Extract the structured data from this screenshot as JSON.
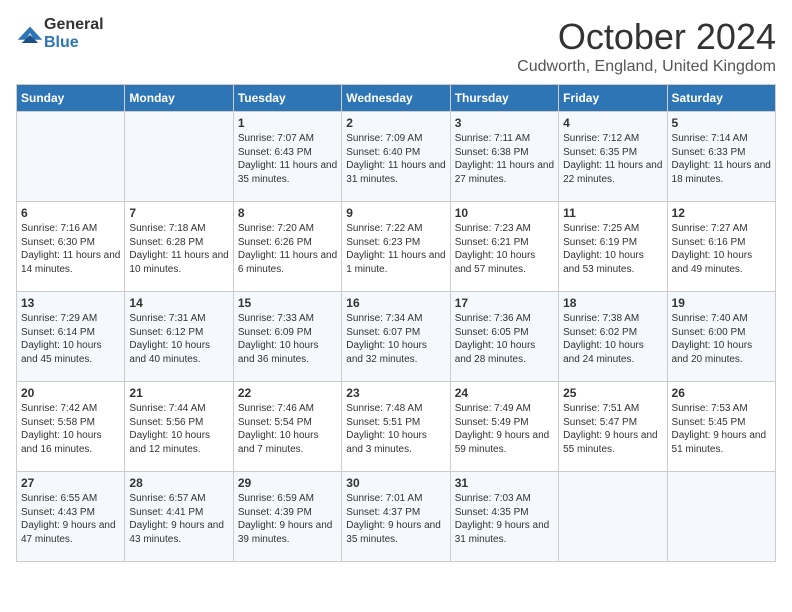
{
  "header": {
    "logo_general": "General",
    "logo_blue": "Blue",
    "month": "October 2024",
    "location": "Cudworth, England, United Kingdom"
  },
  "weekdays": [
    "Sunday",
    "Monday",
    "Tuesday",
    "Wednesday",
    "Thursday",
    "Friday",
    "Saturday"
  ],
  "weeks": [
    [
      {
        "day": "",
        "info": ""
      },
      {
        "day": "",
        "info": ""
      },
      {
        "day": "1",
        "info": "Sunrise: 7:07 AM\nSunset: 6:43 PM\nDaylight: 11 hours and 35 minutes."
      },
      {
        "day": "2",
        "info": "Sunrise: 7:09 AM\nSunset: 6:40 PM\nDaylight: 11 hours and 31 minutes."
      },
      {
        "day": "3",
        "info": "Sunrise: 7:11 AM\nSunset: 6:38 PM\nDaylight: 11 hours and 27 minutes."
      },
      {
        "day": "4",
        "info": "Sunrise: 7:12 AM\nSunset: 6:35 PM\nDaylight: 11 hours and 22 minutes."
      },
      {
        "day": "5",
        "info": "Sunrise: 7:14 AM\nSunset: 6:33 PM\nDaylight: 11 hours and 18 minutes."
      }
    ],
    [
      {
        "day": "6",
        "info": "Sunrise: 7:16 AM\nSunset: 6:30 PM\nDaylight: 11 hours and 14 minutes."
      },
      {
        "day": "7",
        "info": "Sunrise: 7:18 AM\nSunset: 6:28 PM\nDaylight: 11 hours and 10 minutes."
      },
      {
        "day": "8",
        "info": "Sunrise: 7:20 AM\nSunset: 6:26 PM\nDaylight: 11 hours and 6 minutes."
      },
      {
        "day": "9",
        "info": "Sunrise: 7:22 AM\nSunset: 6:23 PM\nDaylight: 11 hours and 1 minute."
      },
      {
        "day": "10",
        "info": "Sunrise: 7:23 AM\nSunset: 6:21 PM\nDaylight: 10 hours and 57 minutes."
      },
      {
        "day": "11",
        "info": "Sunrise: 7:25 AM\nSunset: 6:19 PM\nDaylight: 10 hours and 53 minutes."
      },
      {
        "day": "12",
        "info": "Sunrise: 7:27 AM\nSunset: 6:16 PM\nDaylight: 10 hours and 49 minutes."
      }
    ],
    [
      {
        "day": "13",
        "info": "Sunrise: 7:29 AM\nSunset: 6:14 PM\nDaylight: 10 hours and 45 minutes."
      },
      {
        "day": "14",
        "info": "Sunrise: 7:31 AM\nSunset: 6:12 PM\nDaylight: 10 hours and 40 minutes."
      },
      {
        "day": "15",
        "info": "Sunrise: 7:33 AM\nSunset: 6:09 PM\nDaylight: 10 hours and 36 minutes."
      },
      {
        "day": "16",
        "info": "Sunrise: 7:34 AM\nSunset: 6:07 PM\nDaylight: 10 hours and 32 minutes."
      },
      {
        "day": "17",
        "info": "Sunrise: 7:36 AM\nSunset: 6:05 PM\nDaylight: 10 hours and 28 minutes."
      },
      {
        "day": "18",
        "info": "Sunrise: 7:38 AM\nSunset: 6:02 PM\nDaylight: 10 hours and 24 minutes."
      },
      {
        "day": "19",
        "info": "Sunrise: 7:40 AM\nSunset: 6:00 PM\nDaylight: 10 hours and 20 minutes."
      }
    ],
    [
      {
        "day": "20",
        "info": "Sunrise: 7:42 AM\nSunset: 5:58 PM\nDaylight: 10 hours and 16 minutes."
      },
      {
        "day": "21",
        "info": "Sunrise: 7:44 AM\nSunset: 5:56 PM\nDaylight: 10 hours and 12 minutes."
      },
      {
        "day": "22",
        "info": "Sunrise: 7:46 AM\nSunset: 5:54 PM\nDaylight: 10 hours and 7 minutes."
      },
      {
        "day": "23",
        "info": "Sunrise: 7:48 AM\nSunset: 5:51 PM\nDaylight: 10 hours and 3 minutes."
      },
      {
        "day": "24",
        "info": "Sunrise: 7:49 AM\nSunset: 5:49 PM\nDaylight: 9 hours and 59 minutes."
      },
      {
        "day": "25",
        "info": "Sunrise: 7:51 AM\nSunset: 5:47 PM\nDaylight: 9 hours and 55 minutes."
      },
      {
        "day": "26",
        "info": "Sunrise: 7:53 AM\nSunset: 5:45 PM\nDaylight: 9 hours and 51 minutes."
      }
    ],
    [
      {
        "day": "27",
        "info": "Sunrise: 6:55 AM\nSunset: 4:43 PM\nDaylight: 9 hours and 47 minutes."
      },
      {
        "day": "28",
        "info": "Sunrise: 6:57 AM\nSunset: 4:41 PM\nDaylight: 9 hours and 43 minutes."
      },
      {
        "day": "29",
        "info": "Sunrise: 6:59 AM\nSunset: 4:39 PM\nDaylight: 9 hours and 39 minutes."
      },
      {
        "day": "30",
        "info": "Sunrise: 7:01 AM\nSunset: 4:37 PM\nDaylight: 9 hours and 35 minutes."
      },
      {
        "day": "31",
        "info": "Sunrise: 7:03 AM\nSunset: 4:35 PM\nDaylight: 9 hours and 31 minutes."
      },
      {
        "day": "",
        "info": ""
      },
      {
        "day": "",
        "info": ""
      }
    ]
  ]
}
